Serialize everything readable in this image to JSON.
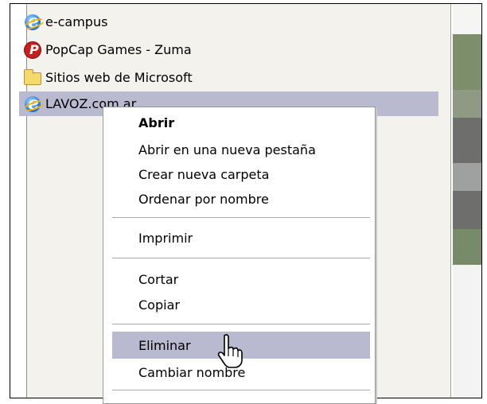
{
  "favorites": [
    {
      "label": "e-campus",
      "icon": "ie-icon"
    },
    {
      "label": "PopCap Games - Zuma",
      "icon": "popcap-icon"
    },
    {
      "label": "Sitios web de Microsoft",
      "icon": "folder-icon"
    },
    {
      "label": "LAVOZ.com.ar",
      "icon": "ie-icon",
      "selected": true
    }
  ],
  "context_menu": {
    "open": "Abrir",
    "open_new_tab": "Abrir en una nueva pestaña",
    "new_folder": "Crear nueva carpeta",
    "sort_by_name": "Ordenar por nombre",
    "print": "Imprimir",
    "cut": "Cortar",
    "copy": "Copiar",
    "delete": "Eliminar",
    "rename": "Cambiar nombre"
  },
  "colors": {
    "selection": "#b9b9cf",
    "panel": "#f3f2ec"
  }
}
